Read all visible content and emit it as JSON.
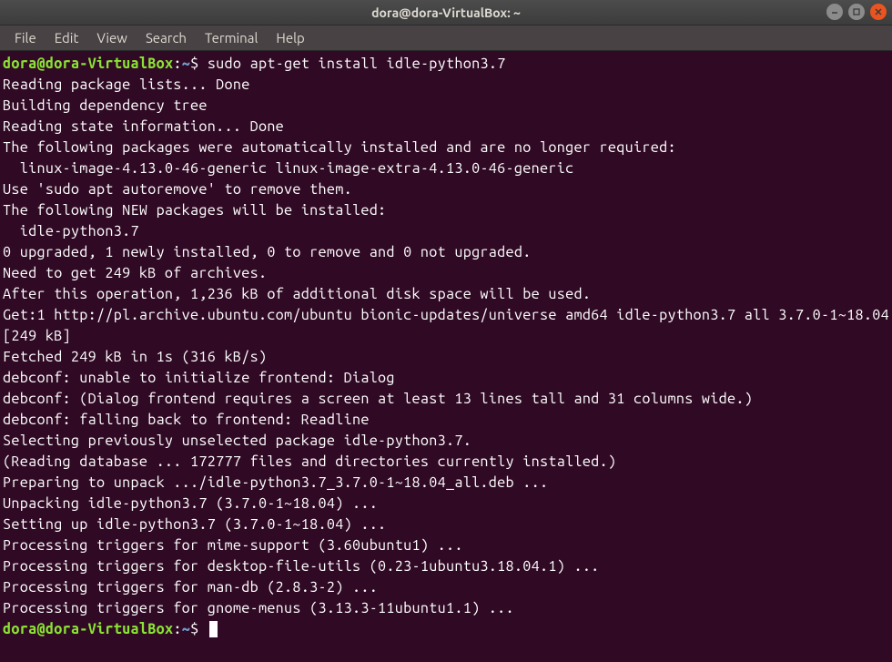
{
  "window": {
    "title": "dora@dora-VirtualBox: ~"
  },
  "menubar": {
    "items": [
      "File",
      "Edit",
      "View",
      "Search",
      "Terminal",
      "Help"
    ]
  },
  "prompt": {
    "user": "dora",
    "at": "@",
    "host": "dora-VirtualBox",
    "colon": ":",
    "path": "~",
    "dollar": "$"
  },
  "command1": " sudo apt-get install idle-python3.7",
  "output_lines": [
    "Reading package lists... Done",
    "Building dependency tree",
    "Reading state information... Done",
    "The following packages were automatically installed and are no longer required:",
    "  linux-image-4.13.0-46-generic linux-image-extra-4.13.0-46-generic",
    "Use 'sudo apt autoremove' to remove them.",
    "The following NEW packages will be installed:",
    "  idle-python3.7",
    "0 upgraded, 1 newly installed, 0 to remove and 0 not upgraded.",
    "Need to get 249 kB of archives.",
    "After this operation, 1,236 kB of additional disk space will be used.",
    "Get:1 http://pl.archive.ubuntu.com/ubuntu bionic-updates/universe amd64 idle-python3.7 all 3.7.0-1~18.04 [249 kB]",
    "Fetched 249 kB in 1s (316 kB/s)",
    "debconf: unable to initialize frontend: Dialog",
    "debconf: (Dialog frontend requires a screen at least 13 lines tall and 31 columns wide.)",
    "debconf: falling back to frontend: Readline",
    "Selecting previously unselected package idle-python3.7.",
    "(Reading database ... 172777 files and directories currently installed.)",
    "Preparing to unpack .../idle-python3.7_3.7.0-1~18.04_all.deb ...",
    "Unpacking idle-python3.7 (3.7.0-1~18.04) ...",
    "Setting up idle-python3.7 (3.7.0-1~18.04) ...",
    "Processing triggers for mime-support (3.60ubuntu1) ...",
    "Processing triggers for desktop-file-utils (0.23-1ubuntu3.18.04.1) ...",
    "Processing triggers for man-db (2.8.3-2) ...",
    "Processing triggers for gnome-menus (3.13.3-11ubuntu1.1) ..."
  ],
  "command2": " "
}
